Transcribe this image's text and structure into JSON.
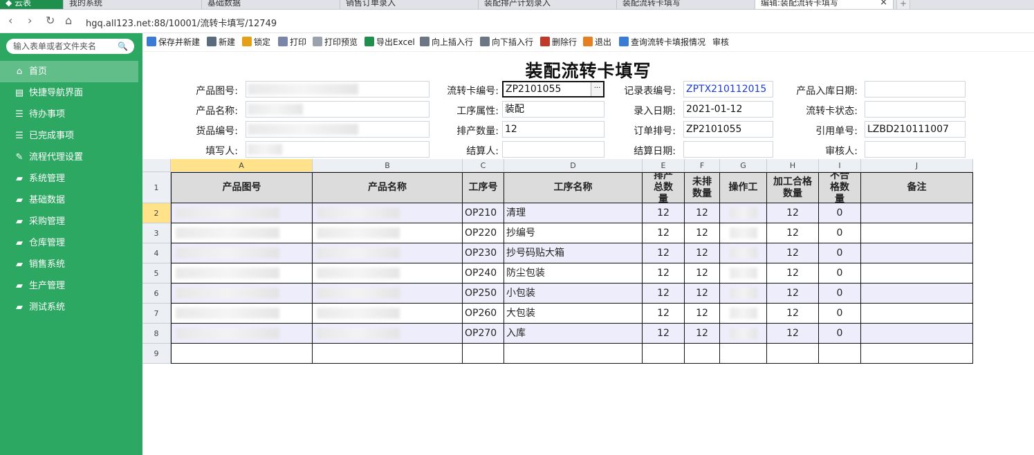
{
  "tabs": [
    {
      "label": "云表"
    },
    {
      "label": "我的系统"
    },
    {
      "label": "基础数据"
    },
    {
      "label": "销售订单录入"
    },
    {
      "label": "装配排产计划录入"
    },
    {
      "label": "装配流转卡填写"
    },
    {
      "label": "编辑:装配流转卡填写"
    }
  ],
  "address": {
    "url": "hgq.all123.net:88/10001/流转卡填写/12749"
  },
  "sidebar": {
    "search_placeholder": "输入表单或者文件夹名",
    "items": [
      {
        "label": "首页",
        "icon": "home-icon"
      },
      {
        "label": "快捷导航界面",
        "icon": "document-icon"
      },
      {
        "label": "待办事项",
        "icon": "list-icon"
      },
      {
        "label": "已完成事项",
        "icon": "list-icon"
      },
      {
        "label": "流程代理设置",
        "icon": "document-edit-icon"
      },
      {
        "label": "系统管理",
        "icon": "folder-icon"
      },
      {
        "label": "基础数据",
        "icon": "folder-icon"
      },
      {
        "label": "采购管理",
        "icon": "folder-icon"
      },
      {
        "label": "仓库管理",
        "icon": "folder-icon"
      },
      {
        "label": "销售系统",
        "icon": "folder-icon"
      },
      {
        "label": "生产管理",
        "icon": "folder-icon"
      },
      {
        "label": "测试系统",
        "icon": "folder-icon"
      }
    ]
  },
  "toolbar": {
    "save_new": "保存并新建",
    "new": "新建",
    "lock": "锁定",
    "print": "打印",
    "print_preview": "打印预览",
    "export_excel": "导出Excel",
    "insert_up": "向上插入行",
    "insert_down": "向下插入行",
    "delete_row": "删除行",
    "exit": "退出",
    "query": "查询流转卡填报情况",
    "review": "审核"
  },
  "form": {
    "title": "装配流转卡填写",
    "labels": {
      "product_drawing": "产品图号:",
      "product_name": "产品名称:",
      "goods_no": "货品编号:",
      "filler": "填写人:",
      "card_no": "流转卡编号:",
      "process_attr": "工序属性:",
      "plan_qty": "排产数量:",
      "settler": "结算人:",
      "record_no": "记录表编号:",
      "entry_date": "录入日期:",
      "order_no": "订单排号:",
      "settle_date": "结算日期:",
      "stock_date": "产品入库日期:",
      "card_status": "流转卡状态:",
      "ref_no": "引用单号:",
      "reviewer": "审核人:"
    },
    "values": {
      "card_no": "ZP2101055",
      "process_attr": "装配",
      "plan_qty": "12",
      "settler": "",
      "record_no": "ZPTX210112015",
      "entry_date": "2021-01-12",
      "order_no": "ZP2101055",
      "settle_date": "",
      "stock_date": "",
      "card_status": "",
      "ref_no": "LZBD210111007",
      "reviewer": ""
    }
  },
  "grid": {
    "columns": [
      "A",
      "B",
      "C",
      "D",
      "E",
      "F",
      "G",
      "H",
      "I",
      "J"
    ],
    "headers": {
      "a": "产品图号",
      "b": "产品名称",
      "c": "工序号",
      "d": "工序名称",
      "e": "排产总数量",
      "f": "未排数量",
      "g": "操作工",
      "h": "加工合格数量",
      "i": "不合格数量",
      "j": "备注"
    },
    "rows": [
      {
        "num": "2",
        "op": "OP210",
        "name": "清理",
        "total": "12",
        "unplanned": "12",
        "ok": "12",
        "ng": "0"
      },
      {
        "num": "3",
        "op": "OP220",
        "name": "抄编号",
        "total": "12",
        "unplanned": "12",
        "ok": "12",
        "ng": "0"
      },
      {
        "num": "4",
        "op": "OP230",
        "name": "抄号码贴大箱",
        "total": "12",
        "unplanned": "12",
        "ok": "12",
        "ng": "0"
      },
      {
        "num": "5",
        "op": "OP240",
        "name": "防尘包装",
        "total": "12",
        "unplanned": "12",
        "ok": "12",
        "ng": "0"
      },
      {
        "num": "6",
        "op": "OP250",
        "name": "小包装",
        "total": "12",
        "unplanned": "12",
        "ok": "12",
        "ng": "0"
      },
      {
        "num": "7",
        "op": "OP260",
        "name": "大包装",
        "total": "12",
        "unplanned": "12",
        "ok": "12",
        "ng": "0"
      },
      {
        "num": "8",
        "op": "OP270",
        "name": "入库",
        "total": "12",
        "unplanned": "12",
        "ok": "12",
        "ng": "0"
      }
    ],
    "header_row_num": "1",
    "empty_row_num": "9"
  }
}
